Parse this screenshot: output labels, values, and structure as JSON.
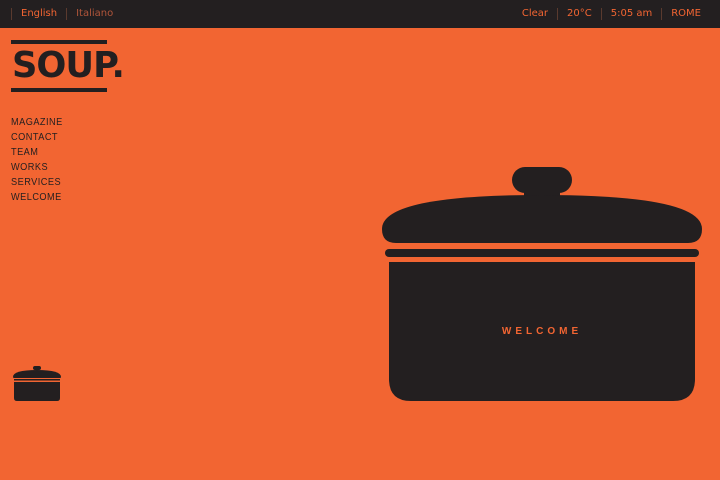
{
  "top_bar": {
    "languages": [
      {
        "label": "English",
        "active": true
      },
      {
        "label": "Italiano",
        "active": false
      }
    ],
    "weather": "Clear",
    "temperature": "20°C",
    "time": "5:05 am",
    "city": "ROME"
  },
  "logo": {
    "text": "SOUP."
  },
  "nav": {
    "items": [
      "MAGAZINE",
      "CONTACT",
      "TEAM",
      "WORKS",
      "SERVICES",
      "WELCOME"
    ]
  },
  "pot": {
    "label": "WELCOME"
  },
  "colors": {
    "background": "#f26532",
    "dark": "#231f20",
    "accent": "#f26532"
  },
  "icons": {
    "small_pot": "pot-icon",
    "big_pot": "pot-illustration"
  }
}
